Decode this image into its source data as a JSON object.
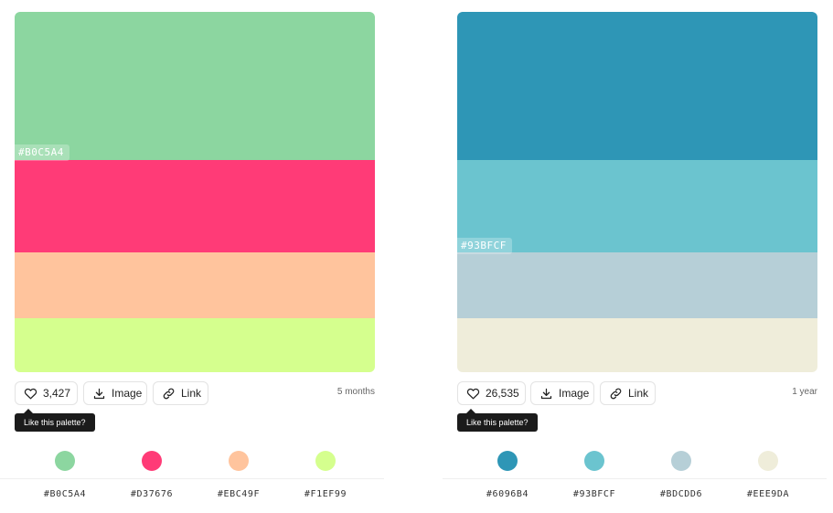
{
  "palettes": [
    {
      "colors": [
        "#8CD6A0",
        "#FF3B77",
        "#FFC49D",
        "#D5FF8E"
      ],
      "label": "#B0C5A4",
      "likes": "3,427",
      "image_label": "Image",
      "link_label": "Link",
      "age": "5 months",
      "tooltip": "Like this palette?",
      "codes": [
        "#B0C5A4",
        "#D37676",
        "#EBC49F",
        "#F1EF99"
      ]
    },
    {
      "colors": [
        "#2E96B6",
        "#6BC4CF",
        "#B6CFD7",
        "#EFEDDA"
      ],
      "label": "#93BFCF",
      "likes": "26,535",
      "image_label": "Image",
      "link_label": "Link",
      "age": "1 year",
      "tooltip": "Like this palette?",
      "codes": [
        "#6096B4",
        "#93BFCF",
        "#BDCDD6",
        "#EEE9DA"
      ]
    }
  ]
}
